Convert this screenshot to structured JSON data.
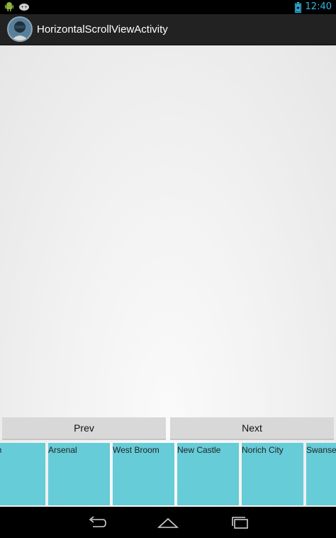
{
  "status_bar": {
    "time": "12:40",
    "icons": [
      "android-debug-icon",
      "android-notification-icon",
      "battery-charging-icon"
    ]
  },
  "action_bar": {
    "title": "HorizontalScrollViewActivity",
    "icon": "app-avatar-icon"
  },
  "buttons": {
    "prev_label": "Prev",
    "next_label": "Next"
  },
  "scroll_items": [
    {
      "label": "Ham"
    },
    {
      "label": "Arsenal"
    },
    {
      "label": "West Broom"
    },
    {
      "label": "New Castle"
    },
    {
      "label": "Norich City"
    },
    {
      "label": "Swansea"
    }
  ],
  "nav_bar": {
    "icons": [
      "back-icon",
      "home-icon",
      "recent-apps-icon"
    ]
  },
  "colors": {
    "accent": "#33b5e5",
    "tile": "#65ccd8",
    "action_bar": "#222222"
  }
}
